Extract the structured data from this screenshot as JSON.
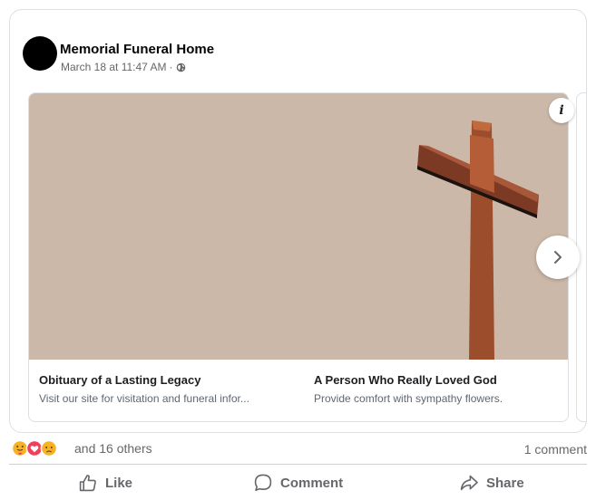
{
  "post": {
    "page_name": "Memorial Funeral Home",
    "timestamp": "March 18 at 11:47 AM",
    "separator": "·",
    "audience_icon": "globe-icon"
  },
  "carousel": {
    "cards": [
      {
        "title": "Obituary of a Lasting Legacy",
        "subtitle": "Visit our site for visitation and funeral infor..."
      },
      {
        "title": "A Person Who Really Loved God",
        "subtitle": "Provide comfort with sympathy flowers."
      }
    ],
    "info_icon": "i",
    "next_icon": "chevron-right-icon",
    "image_background": "#cbb8a8"
  },
  "reactions": {
    "icons": [
      "care-icon",
      "love-icon",
      "sad-icon"
    ],
    "summary": "and 16 others",
    "comments": "1 comment"
  },
  "actions": {
    "like": "Like",
    "comment": "Comment",
    "share": "Share"
  },
  "colors": {
    "secondary_text": "#65676b",
    "love_red": "#f33e58",
    "emoji_yellow": "#f7b125"
  }
}
